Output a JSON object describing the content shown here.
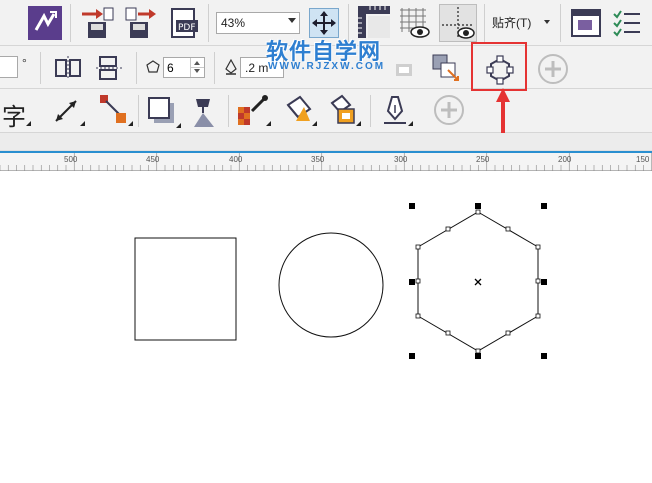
{
  "toolbar1": {
    "zoom_value": "43%",
    "snap_label": "贴齐(T)"
  },
  "toolbar2": {
    "degree_symbol": "°",
    "sides_value": "6",
    "outline_value": ".2 m"
  },
  "toolbar3": {
    "text_tool_glyph": "字"
  },
  "watermark": {
    "title": "软件自学网",
    "url": "WWW.RJZXW.COM"
  },
  "ruler": {
    "labels": [
      "500",
      "450",
      "400",
      "350",
      "300",
      "250",
      "200",
      "150"
    ]
  },
  "colors": {
    "highlight": "#e53333",
    "watermark": "#2e7fd1",
    "ruler_accent": "#2a8fd0"
  }
}
